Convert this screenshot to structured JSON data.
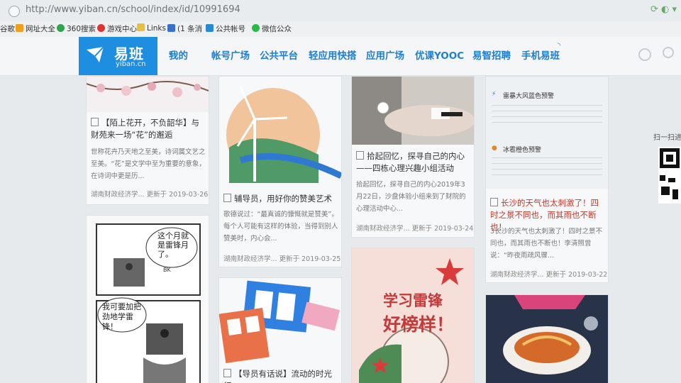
{
  "browser": {
    "url": "http://www.yiban.cn/school/index/id/10991694",
    "bookmarks": [
      "谷歌",
      "网址大全",
      "360搜索",
      "游戏中心",
      "Links",
      "(1 条消",
      "公共帐号",
      "微信公众"
    ]
  },
  "site": {
    "logo_name": "易班",
    "logo_domain": "yiban.cn",
    "nav": [
      "我的",
      "帐号广场",
      "公共平台",
      "轻应用快搭",
      "应用广场",
      "优课YOOC",
      "易智招聘",
      "手机易班"
    ],
    "qr_label": "扫一扫进"
  },
  "cards": {
    "c1": {
      "title": "【陌上花开，不负韶华】与财苑来一场“花”的邂逅",
      "desc": "世称花卉乃天地之至美，诗词属文艺之至美。“花”是文学中至为重要的意象，在诗词中更是历...",
      "org": "湖南财政经济学...",
      "updated": "更新于 2019-03-26"
    },
    "c2": {
      "title": "辅导员，用好你的赞美艺术",
      "desc": "歌德说过：“最真诚的慷慨就是赞美”。每个人可能有这样的体验，当得到别人赞美时，内心会...",
      "org": "湖南财政经济学...",
      "updated": "更新于 2019-03-25"
    },
    "c3": {
      "title": "拾起回忆，探寻自己的内心——四栋心理兴趣小组活动",
      "desc": "拾起回忆，探寻自己的内心2019年3月22日，沙盘体验小组来到了财院的心理活动中心...",
      "org": "湖南财政经济学...",
      "updated": "更新于 2019-03-24"
    },
    "c4": {
      "alert1": "雷暴大风蓝色预警",
      "alert2": "冰雹橙色预警",
      "title": "长沙的天气也太刺激了！四时之景不同也，而其雨也不断也！",
      "desc": "3长沙的天气也太刺激了！四时之景不同也，而其雨也不断也！李清照曾说：“昨夜雨疏风骤...",
      "org": "湖南财政经济学...",
      "updated": "更新于 2019-03-22"
    },
    "comic": {
      "bubble1": "这个月就是雷锋月了。",
      "bubble2": "我可要加把劲地学雷锋！",
      "sfx": "BK"
    },
    "poster": {
      "line1": "学习雷锋",
      "line2": "好榜样！"
    },
    "c6": {
      "title": "【导员有话说】流动的时光 行"
    }
  },
  "colors": {
    "brand": "#1e8fe0",
    "nav": "#1e7fd2",
    "alert_red": "#c0392b"
  }
}
